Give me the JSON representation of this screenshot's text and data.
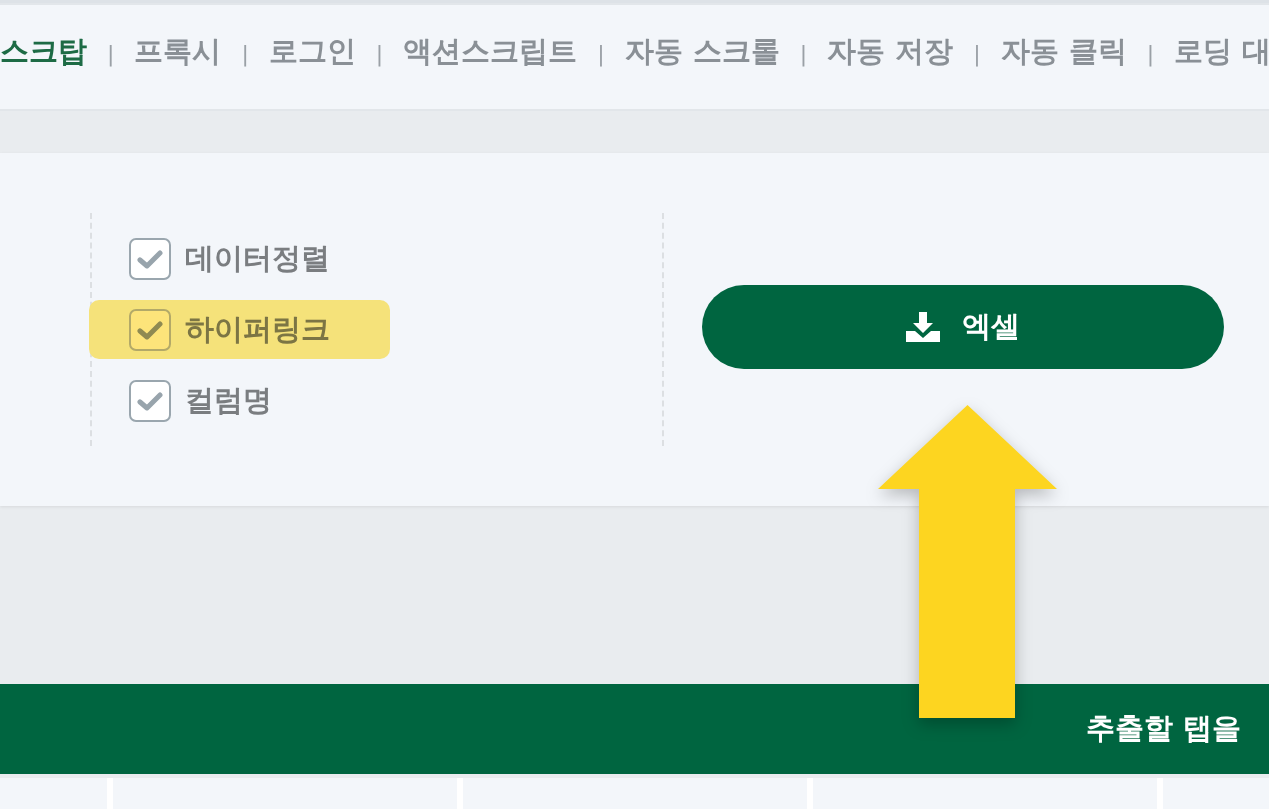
{
  "nav": {
    "items": [
      {
        "label": "스크탑",
        "selected": true
      },
      {
        "label": "프록시",
        "selected": false
      },
      {
        "label": "로그인",
        "selected": false
      },
      {
        "label": "액션스크립트",
        "selected": false
      },
      {
        "label": "자동 스크롤",
        "selected": false
      },
      {
        "label": "자동 저장",
        "selected": false
      },
      {
        "label": "자동 클릭",
        "selected": false
      },
      {
        "label": "로딩 대",
        "selected": false
      }
    ],
    "separator": "|"
  },
  "options": [
    {
      "label": "데이터정렬",
      "checked": true,
      "highlighted": false
    },
    {
      "label": "하이퍼링크",
      "checked": true,
      "highlighted": true
    },
    {
      "label": "컬럼명",
      "checked": true,
      "highlighted": false
    }
  ],
  "excel_button": {
    "label": "엑셀"
  },
  "banner": {
    "text": "추출할 탭을"
  }
}
